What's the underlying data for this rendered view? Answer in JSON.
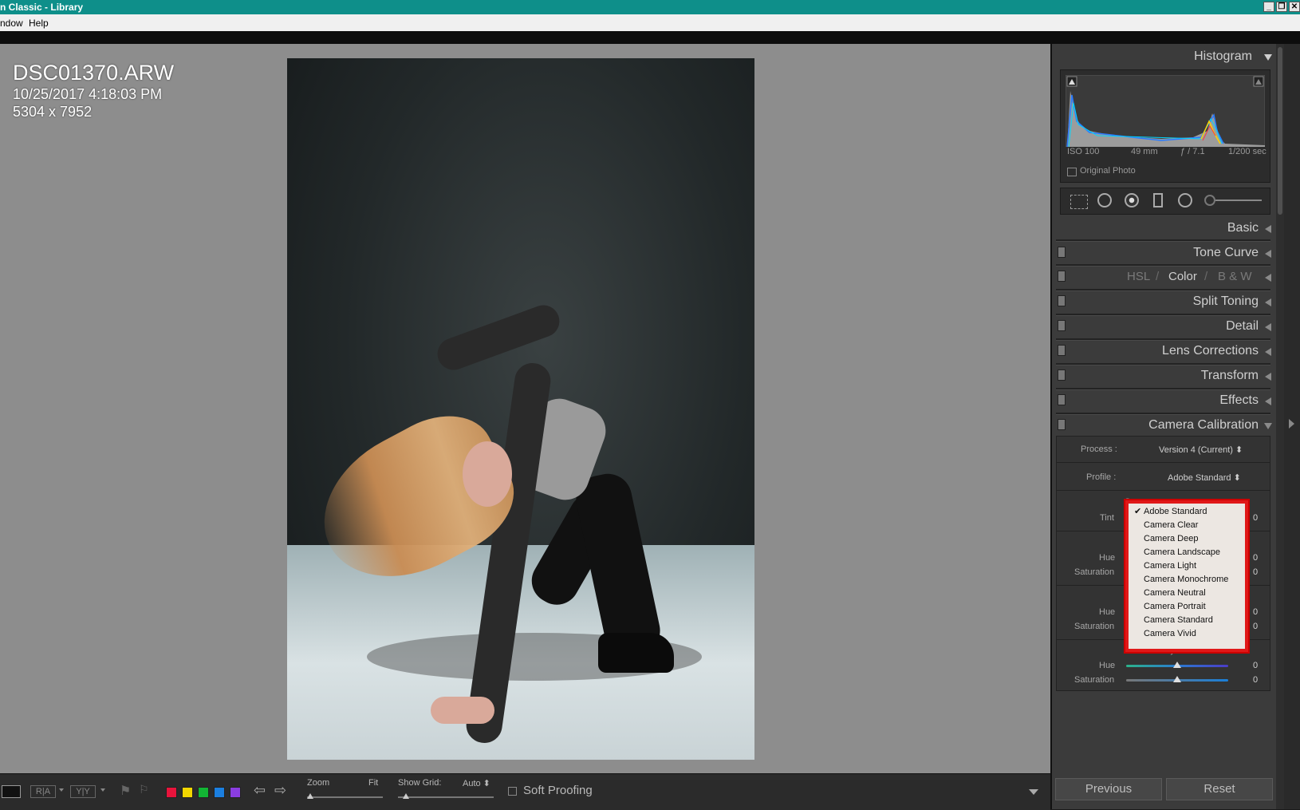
{
  "window": {
    "title": "n Classic - Library",
    "buttons": [
      "_",
      "❐",
      "✕"
    ]
  },
  "menu": {
    "items": [
      "ndow",
      "Help"
    ]
  },
  "photo_info": {
    "filename": "DSC01370.ARW",
    "datetime": "10/25/2017 4:18:03 PM",
    "dimensions": "5304 x 7952"
  },
  "histogram": {
    "title": "Histogram",
    "iso": "ISO 100",
    "focal": "49 mm",
    "aperture": "ƒ / 7.1",
    "shutter": "1/200 sec",
    "original_photo": "Original Photo"
  },
  "panels": {
    "basic": "Basic",
    "tone_curve": "Tone Curve",
    "hsl": "HSL",
    "color": "Color",
    "bw": "B & W",
    "slash": "/",
    "split_toning": "Split Toning",
    "detail": "Detail",
    "lens_corrections": "Lens Corrections",
    "transform": "Transform",
    "effects": "Effects",
    "camera_calibration": "Camera Calibration"
  },
  "calibration": {
    "process_label": "Process :",
    "process_value": "Version 4 (Current) ⬍",
    "profile_label": "Profile :",
    "profile_value": "Adobe Standard ⬍",
    "shadows_tint_label": "Tint",
    "shadows_tint_value": "0",
    "red_hue_label": "Hue",
    "red_hue_value": "0",
    "red_sat_label": "Saturation",
    "red_sat_value": "0",
    "green_hue_label": "Hue",
    "green_hue_value": "0",
    "green_sat_label": "Saturation",
    "green_sat_value": "0",
    "blue_primary_title": "Blue Primary",
    "blue_hue_label": "Hue",
    "blue_hue_value": "0",
    "blue_sat_label": "Saturation",
    "blue_sat_value": "0",
    "partial_letters": [
      "S",
      "R",
      "G"
    ]
  },
  "profile_dropdown": {
    "selected": "Adobe Standard",
    "options": [
      "Adobe Standard",
      "Camera Clear",
      "Camera Deep",
      "Camera Landscape",
      "Camera Light",
      "Camera Monochrome",
      "Camera Neutral",
      "Camera Portrait",
      "Camera Standard",
      "Camera Vivid"
    ],
    "checkmark": "✔"
  },
  "toolbar": {
    "zoom_label": "Zoom",
    "zoom_value": "Fit",
    "show_grid_label": "Show Grid:",
    "show_grid_value": "Auto ⬍",
    "soft_proofing": "Soft Proofing",
    "color_labels": [
      "#e8143c",
      "#f2d600",
      "#12b534",
      "#1b7fe0",
      "#8a3de0"
    ]
  },
  "footer_buttons": {
    "previous": "Previous",
    "reset": "Reset"
  },
  "colors": {
    "title_bar": "#0e8f8a",
    "highlight_border": "#e01818",
    "panel_bg": "#3b3b3b",
    "main_bg": "#8d8d8d"
  }
}
